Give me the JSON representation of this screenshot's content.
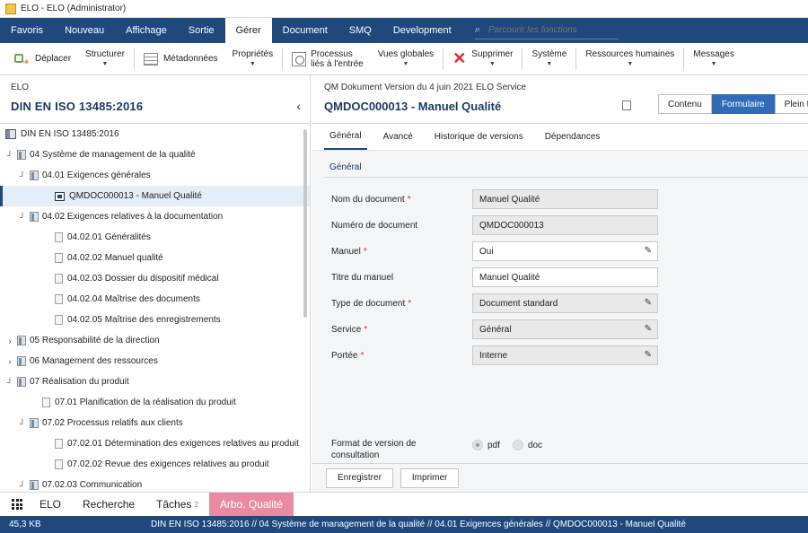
{
  "window": {
    "title": "ELO - ELO (Administrator)"
  },
  "ribbon": {
    "tabs": [
      {
        "label": "Favoris",
        "active": false
      },
      {
        "label": "Nouveau",
        "active": false
      },
      {
        "label": "Affichage",
        "active": false
      },
      {
        "label": "Sortie",
        "active": false
      },
      {
        "label": "Gérer",
        "active": true
      },
      {
        "label": "Document",
        "active": false
      },
      {
        "label": "SMQ",
        "active": false
      },
      {
        "label": "Development",
        "active": false
      }
    ],
    "search_placeholder": "Parcourir les fonctions"
  },
  "toolbar": {
    "move": "Déplacer",
    "structure": "Structurer",
    "metadata": "Métadonnées",
    "properties": "Propriétés",
    "process_l1": "Processus",
    "process_l2": "liés à l'entrée",
    "global_views": "Vues globales",
    "delete": "Supprimer",
    "system": "Système",
    "hr": "Ressources humaines",
    "messages": "Messages"
  },
  "left": {
    "sub": "ELO",
    "title": "DIN EN ISO 13485:2016",
    "tree": [
      {
        "label": "DIN EN ISO 13485:2016",
        "indent": 0,
        "toggle": "",
        "icon": "archive"
      },
      {
        "label": "04 Système de management de la qualité",
        "indent": 0,
        "toggle": "┘",
        "icon": "folder"
      },
      {
        "label": "04.01 Exigences générales",
        "indent": 1,
        "toggle": "┘",
        "icon": "folder"
      },
      {
        "label": "QMDOC000013 - Manuel Qualité",
        "indent": 3,
        "toggle": "",
        "icon": "doc",
        "selected": true
      },
      {
        "label": "04.02 Exigences relatives à la documentation",
        "indent": 1,
        "toggle": "┘",
        "icon": "folder"
      },
      {
        "label": "04.02.01 Généralités",
        "indent": 3,
        "toggle": "",
        "icon": "page"
      },
      {
        "label": "04.02.02 Manuel qualité",
        "indent": 3,
        "toggle": "",
        "icon": "page"
      },
      {
        "label": "04.02.03 Dossier du dispositif médical",
        "indent": 3,
        "toggle": "",
        "icon": "page"
      },
      {
        "label": "04.02.04 Maîtrise des documents",
        "indent": 3,
        "toggle": "",
        "icon": "page"
      },
      {
        "label": "04.02.05 Maîtrise des enregistrements",
        "indent": 3,
        "toggle": "",
        "icon": "page"
      },
      {
        "label": "05 Responsabilité de la direction",
        "indent": 0,
        "toggle": "›",
        "icon": "folder"
      },
      {
        "label": "06 Management des ressources",
        "indent": 0,
        "toggle": "›",
        "icon": "folder"
      },
      {
        "label": "07 Réalisation du produit",
        "indent": 0,
        "toggle": "┘",
        "icon": "folder"
      },
      {
        "label": "07.01 Planification de la réalisation du produit",
        "indent": 2,
        "toggle": "",
        "icon": "page"
      },
      {
        "label": "07.02 Processus relatifs aux clients",
        "indent": 1,
        "toggle": "┘",
        "icon": "folder"
      },
      {
        "label": "07.02.01 Détermination des exigences relatives au produit",
        "indent": 3,
        "toggle": "",
        "icon": "page"
      },
      {
        "label": "07.02.02 Revue des exigences relatives au produit",
        "indent": 3,
        "toggle": "",
        "icon": "page"
      },
      {
        "label": "07.02.03 Communication",
        "indent": 1,
        "toggle": "┘",
        "icon": "folder"
      }
    ]
  },
  "right": {
    "meta": "QM Dokument  Version  du 4 juin 2021  ELO Service",
    "title": "QMDOC000013 - Manuel Qualité",
    "views": [
      "Contenu",
      "Formulaire",
      "Plein texte"
    ],
    "active_view": "Formulaire",
    "tabs": [
      "Général",
      "Avancé",
      "Historique de versions",
      "Dépendances"
    ],
    "section": "Général",
    "fields": [
      {
        "label": "Nom du document",
        "required": true,
        "value": "Manuel Qualité",
        "editable": false,
        "pen": false
      },
      {
        "label": "Numéro de document",
        "required": false,
        "value": "QMDOC000013",
        "editable": false,
        "pen": false
      },
      {
        "label": "Manuel",
        "required": true,
        "value": "Oui",
        "editable": true,
        "pen": true
      },
      {
        "label": "Titre du manuel",
        "required": false,
        "value": "Manuel Qualité",
        "editable": true,
        "pen": false
      },
      {
        "label": "Type de document",
        "required": true,
        "value": "Document standard",
        "editable": false,
        "pen": true
      },
      {
        "label": "Service",
        "required": true,
        "value": "Général",
        "editable": false,
        "pen": true
      },
      {
        "label": "Portée",
        "required": true,
        "value": "Interne",
        "editable": false,
        "pen": true
      }
    ],
    "format_label_l1": "Format de version de",
    "format_label_l2": "consultation",
    "format_options": [
      "pdf",
      "doc"
    ],
    "format_selected": "pdf",
    "buttons": {
      "save": "Enregistrer",
      "print": "Imprimer"
    }
  },
  "bottom_nav": {
    "items": [
      {
        "label": "ELO",
        "badge": "",
        "active": false
      },
      {
        "label": "Recherche",
        "badge": "",
        "active": false
      },
      {
        "label": "Tâches",
        "badge": "2",
        "active": false
      },
      {
        "label": "Arbo. Qualité",
        "badge": "",
        "active": true
      }
    ]
  },
  "status": {
    "size": "45,3 KB",
    "path": "DIN EN ISO 13485:2016 // 04 Système de management de la qualité // 04.01 Exigences générales // QMDOC000013 - Manuel Qualité"
  },
  "colors": {
    "brand": "#1f497d",
    "accent": "#2f6cb5",
    "active_nav": "#e98aa2",
    "required": "#d62b2b"
  }
}
